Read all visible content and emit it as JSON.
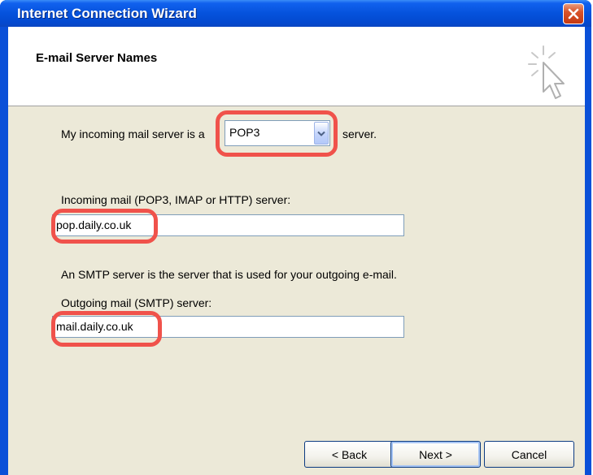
{
  "window": {
    "title": "Internet Connection Wizard"
  },
  "header": {
    "title": "E-mail Server Names"
  },
  "form": {
    "incoming_type_prefix": "My incoming mail server is a",
    "incoming_type_value": "POP3",
    "incoming_type_suffix": "server.",
    "incoming_label": "Incoming mail (POP3, IMAP or HTTP) server:",
    "incoming_value": "pop.daily.co.uk",
    "smtp_description": "An SMTP server is the server that is used for your outgoing e-mail.",
    "outgoing_label": "Outgoing mail (SMTP) server:",
    "outgoing_value": "mail.daily.co.uk"
  },
  "buttons": {
    "back": "< Back",
    "next": "Next >",
    "cancel": "Cancel"
  },
  "colors": {
    "titlebar": "#0552dc",
    "highlight": "#f0524b",
    "dialog_bg": "#ece9d8"
  },
  "icons": [
    "close-icon",
    "wizard-cursor-icon",
    "dropdown-arrow-icon"
  ]
}
